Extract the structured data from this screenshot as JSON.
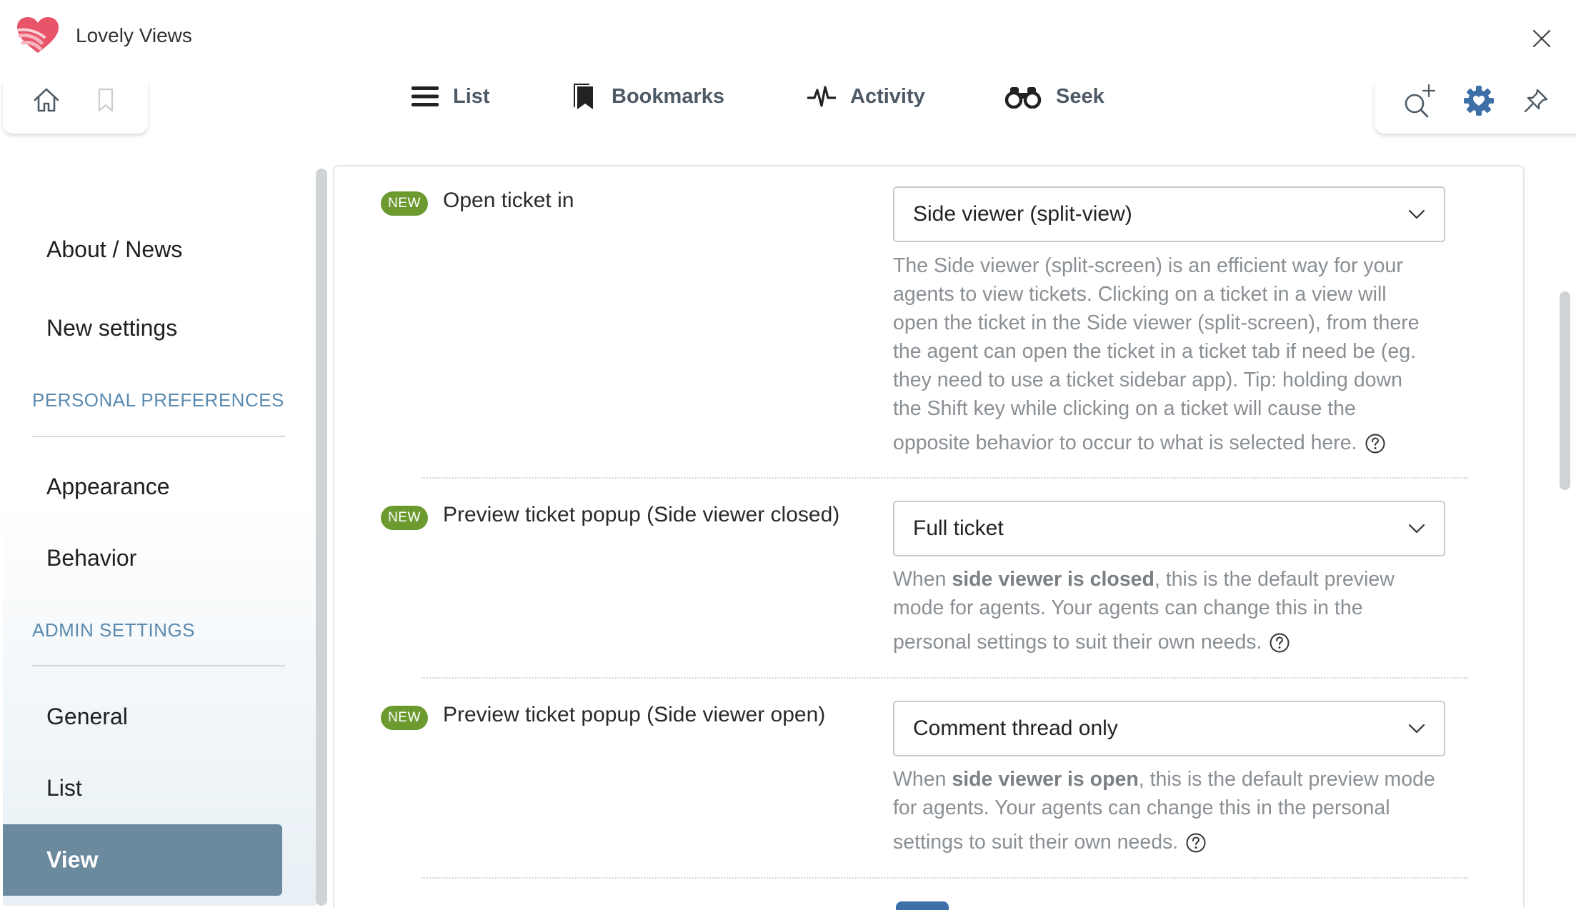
{
  "app": {
    "title": "Lovely Views"
  },
  "nav": {
    "items": [
      {
        "label": "List",
        "icon": "list-icon"
      },
      {
        "label": "Bookmarks",
        "icon": "bookmarks-icon"
      },
      {
        "label": "Activity",
        "icon": "activity-icon"
      },
      {
        "label": "Seek",
        "icon": "binoculars-icon"
      }
    ]
  },
  "toolbar_left": [
    "home-icon",
    "bookmark-icon"
  ],
  "toolbar_right": [
    "search-add-icon",
    "gear-heart-icon",
    "pin-icon"
  ],
  "sidebar": {
    "links_top": [
      "About / News",
      "New settings"
    ],
    "heading_personal": "PERSONAL PREFERENCES",
    "links_personal": [
      "Appearance",
      "Behavior"
    ],
    "heading_admin": "ADMIN SETTINGS",
    "links_admin": [
      "General",
      "List"
    ],
    "active": "View"
  },
  "settings": [
    {
      "badge": "NEW",
      "label": "Open ticket in",
      "selected": "Side viewer (split-view)",
      "help_lines": [
        "The Side viewer (split-screen) is an efficient way for your",
        "agents to view tickets. Clicking on a ticket in a view will",
        "open the ticket in the Side viewer (split-screen), from there",
        "the agent can open the ticket in a ticket tab if need be (eg.",
        "they need to use a ticket sidebar app). Tip: holding down",
        "the Shift key while clicking on a ticket will cause the",
        "opposite behavior to occur to what is selected here."
      ]
    },
    {
      "badge": "NEW",
      "label": "Preview ticket popup (Side viewer closed)",
      "selected": "Full ticket",
      "help_pre": "When ",
      "help_bold": "side viewer is closed",
      "help_post": ", this is the default preview",
      "help_lines": [
        "mode for agents. Your agents can change this in the",
        "personal settings to suit their own needs."
      ]
    },
    {
      "badge": "NEW",
      "label": "Preview ticket popup (Side viewer open)",
      "selected": "Comment thread only",
      "help_pre": "When ",
      "help_bold": "side viewer is open",
      "help_post": ", this is the default preview mode",
      "help_lines": [
        "for agents. Your agents can change this in the personal",
        "settings to suit their own needs."
      ]
    }
  ],
  "colors": {
    "accent": "#3d6fa8",
    "badge": "#6d9a2f",
    "sidebar_active": "#6b8a9e",
    "sidebar_heading": "#5b8bb0",
    "help_text": "#8a8f94"
  }
}
